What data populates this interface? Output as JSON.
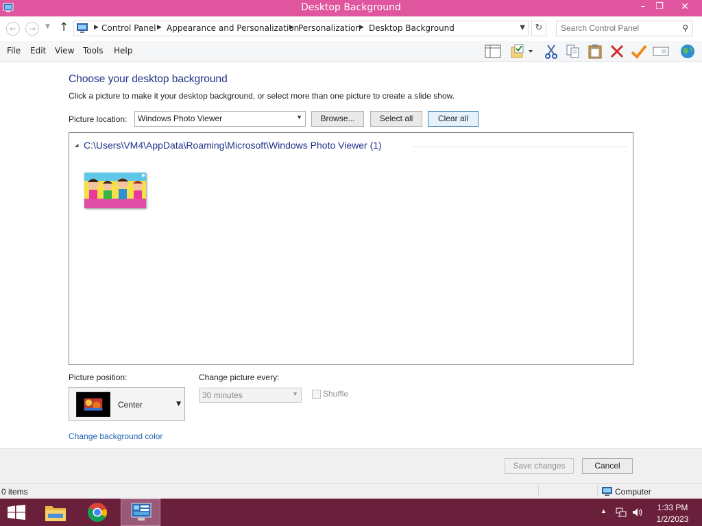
{
  "window": {
    "title": "Desktop Background",
    "controls": {
      "minimize": "–",
      "maximize": "❐",
      "close": "✕"
    },
    "accent_color": "#e0569e"
  },
  "address_bar": {
    "breadcrumbs": [
      "Control Panel",
      "Appearance and Personalization",
      "Personalization",
      "Desktop Background"
    ],
    "search_placeholder": "Search Control Panel"
  },
  "menu": {
    "items": [
      "File",
      "Edit",
      "View",
      "Tools",
      "Help"
    ]
  },
  "toolbar": {
    "icons": [
      "layout-icon",
      "properties-icon",
      "cut-icon",
      "copy-icon",
      "paste-icon",
      "delete-icon",
      "check-icon",
      "rename-icon",
      "globe-icon"
    ]
  },
  "main": {
    "heading": "Choose your desktop background",
    "description": "Click a picture to make it your desktop background, or select more than one picture to create a slide show.",
    "picture_location": {
      "label": "Picture location:",
      "value": "Windows Photo Viewer"
    },
    "buttons": {
      "browse": "Browse...",
      "select_all": "Select all",
      "clear_all": "Clear all"
    },
    "gallery": {
      "group_title": "C:\\Users\\VM4\\AppData\\Roaming\\Microsoft\\Windows Photo Viewer (1)"
    },
    "picture_position": {
      "label": "Picture position:",
      "value": "Center"
    },
    "change_picture": {
      "label": "Change picture every:",
      "value": "30 minutes"
    },
    "shuffle_label": "Shuffle",
    "change_color_link": "Change background color"
  },
  "footer": {
    "save_label": "Save changes",
    "cancel_label": "Cancel"
  },
  "status": {
    "items_count": "0 items",
    "location": "Computer"
  },
  "taskbar": {
    "time": "1:33 PM",
    "date": "1/2/2023",
    "color": "#6a1f3b"
  }
}
